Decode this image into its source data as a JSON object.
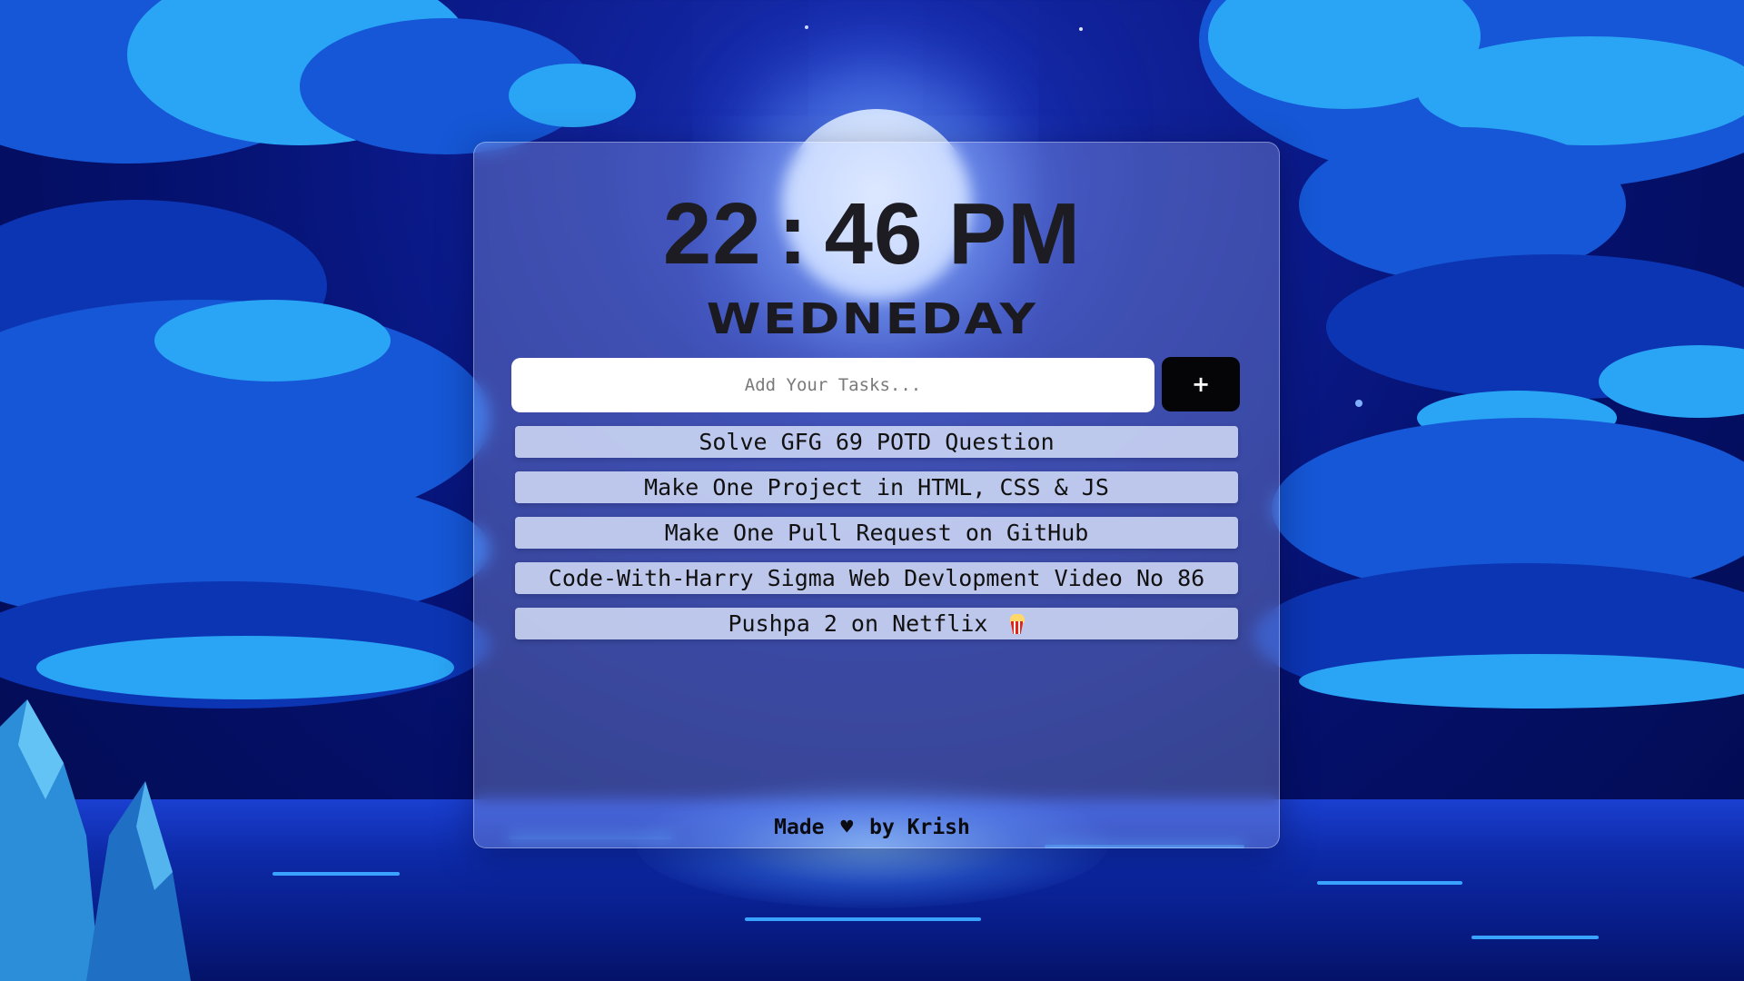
{
  "clock": {
    "hours": "22",
    "separator": ":",
    "minutes": "46",
    "period": "PM"
  },
  "day": "WEDNEDAY",
  "task_input": {
    "placeholder": "Add Your Tasks...",
    "value": ""
  },
  "add_button": {
    "label": "+"
  },
  "tasks": [
    "Solve GFG 69 POTD Question",
    "Make One Project in HTML, CSS & JS",
    "Make One Pull Request on GitHub",
    "Code-With-Harry Sigma Web Devlopment Video No 86",
    "Pushpa 2 on Netflix"
  ],
  "task_icons": {
    "4": "popcorn-icon"
  },
  "footer": {
    "prefix": "Made",
    "heart": "♥",
    "suffix": "by Krish"
  },
  "colors": {
    "sky_top": "#020b4d",
    "cloud_light": "#2aa4f4",
    "cloud_mid": "#1557d6",
    "add_button_bg": "#050507",
    "card_glass": "rgba(190,205,255,0.28)"
  }
}
